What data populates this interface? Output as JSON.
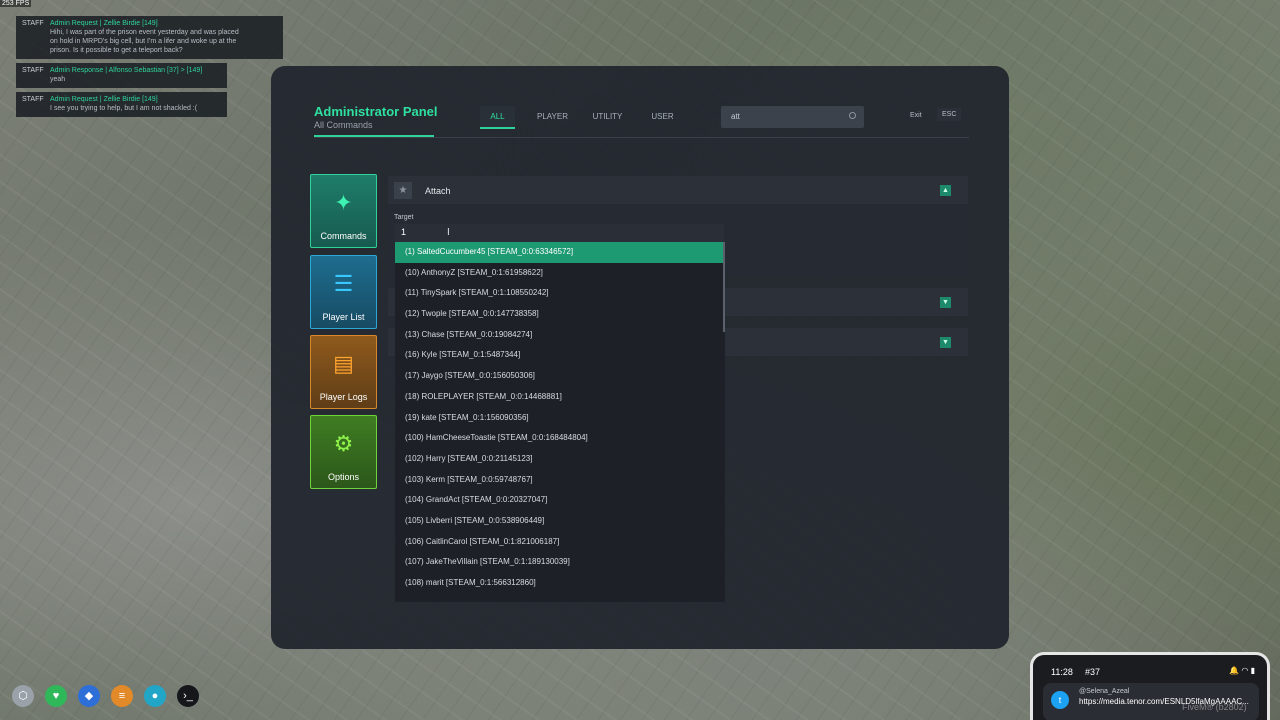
{
  "fps": "253 FPS",
  "chat": [
    {
      "tag": "STAFF",
      "head": "Admin Request | Zellie Birdie [149]",
      "body": [
        "Hihi, I was part of the prison event yesterday and was placed",
        "on hold in MRPD's big cell, but I'm a lifer and woke up at the",
        "prison. Is it possible to get a teleport back?"
      ]
    },
    {
      "tag": "STAFF",
      "head": "Admin Response | Alfonso Sebastian [37] > [149]",
      "body": [
        "yeah"
      ]
    },
    {
      "tag": "STAFF",
      "head": "Admin Request | Zellie Birdie [149]",
      "body": [
        "I see you trying to help, but I am not shackled :("
      ]
    }
  ],
  "panel": {
    "title": "Administrator Panel",
    "subtitle": "All Commands",
    "tabs": [
      "ALL",
      "PLAYER",
      "UTILITY",
      "USER"
    ],
    "active_tab": "ALL",
    "search_value": "att",
    "exit_label": "Exit",
    "esc_label": "ESC"
  },
  "sidebar": [
    {
      "label": "Commands",
      "icon": "commands-icon"
    },
    {
      "label": "Player List",
      "icon": "list-icon"
    },
    {
      "label": "Player Logs",
      "icon": "book-icon"
    },
    {
      "label": "Options",
      "icon": "gears-icon"
    }
  ],
  "command": {
    "name": "Attach",
    "target_label": "Target",
    "target_value": "1"
  },
  "dropdown": [
    "(1) SaltedCucumber45 [STEAM_0:0:63346572]",
    "(10) AnthonyZ [STEAM_0:1:61958622]",
    "(11) TinySpark [STEAM_0:1:108550242]",
    "(12) Twople [STEAM_0:0:147738358]",
    "(13) Chase [STEAM_0:0:19084274]",
    "(16) Kyle [STEAM_0:1:5487344]",
    "(17) Jaygo [STEAM_0:0:156050306]",
    "(18) ROLEPLAYER [STEAM_0:0:14468881]",
    "(19) kate [STEAM_0:1:156090356]",
    "(100) HamCheeseToastie [STEAM_0:0:168484804]",
    "(102) Harry [STEAM_0:0:21145123]",
    "(103) Kerm [STEAM_0:0:59748767]",
    "(104) GrandAct [STEAM_0:0:20327047]",
    "(105) Livberri [STEAM_0:0:538906449]",
    "(106) CaitlinCarol [STEAM_0:1:821006187]",
    "(107) JakeTheVillain [STEAM_0:1:189130039]",
    "(108) marit [STEAM_0:1:566312860]"
  ],
  "phone": {
    "time": "11:28",
    "number": "#37",
    "handle": "@Selena_Azeal",
    "link": "https://media.tenor.com/ESNLD5lfaMgAAAAC..."
  },
  "watermark": "FiveM® (b2802)",
  "colors": {
    "accent": "#2fd39a",
    "panel": "#22262e"
  }
}
